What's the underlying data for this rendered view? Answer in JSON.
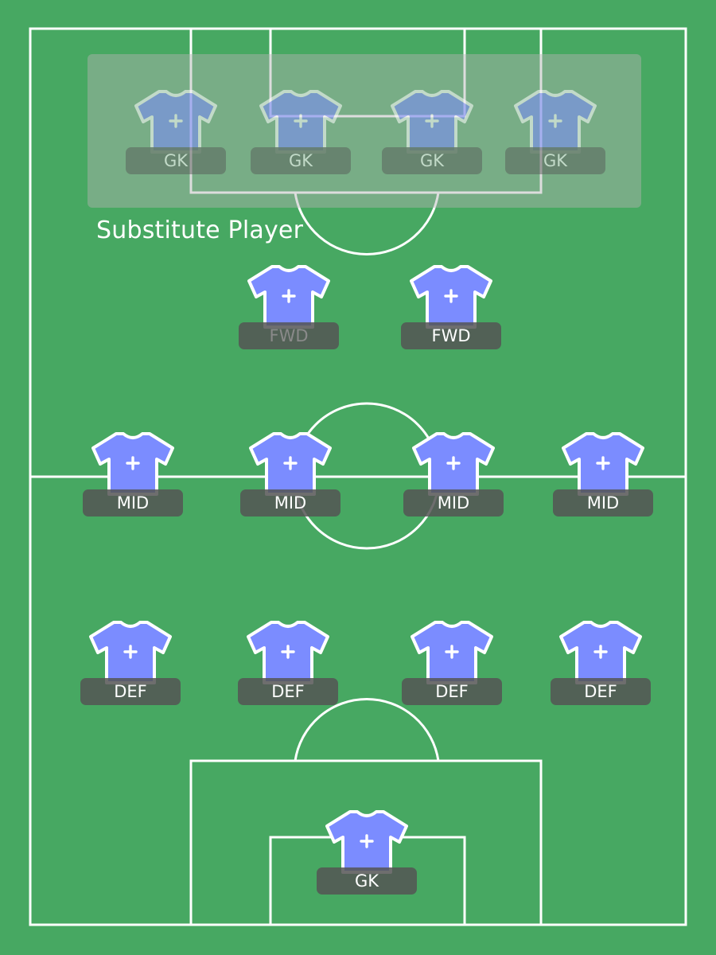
{
  "colors": {
    "grass": "#47a862",
    "lines": "#ffffff",
    "shirt": "#7b8cff",
    "label_bg": "#555555"
  },
  "substitutes": {
    "caption": "Substitute Player",
    "players": [
      {
        "position": "GK"
      },
      {
        "position": "GK"
      },
      {
        "position": "GK"
      },
      {
        "position": "GK"
      }
    ]
  },
  "lineup": {
    "forwards": [
      {
        "position": "FWD",
        "label_dimmed": true
      },
      {
        "position": "FWD",
        "label_dimmed": false
      }
    ],
    "midfielders": [
      {
        "position": "MID"
      },
      {
        "position": "MID"
      },
      {
        "position": "MID"
      },
      {
        "position": "MID"
      }
    ],
    "defenders": [
      {
        "position": "DEF"
      },
      {
        "position": "DEF"
      },
      {
        "position": "DEF"
      },
      {
        "position": "DEF"
      }
    ],
    "goalkeeper": [
      {
        "position": "GK"
      }
    ]
  },
  "icons": {
    "shirt": "shirt-icon",
    "add": "plus-icon"
  }
}
